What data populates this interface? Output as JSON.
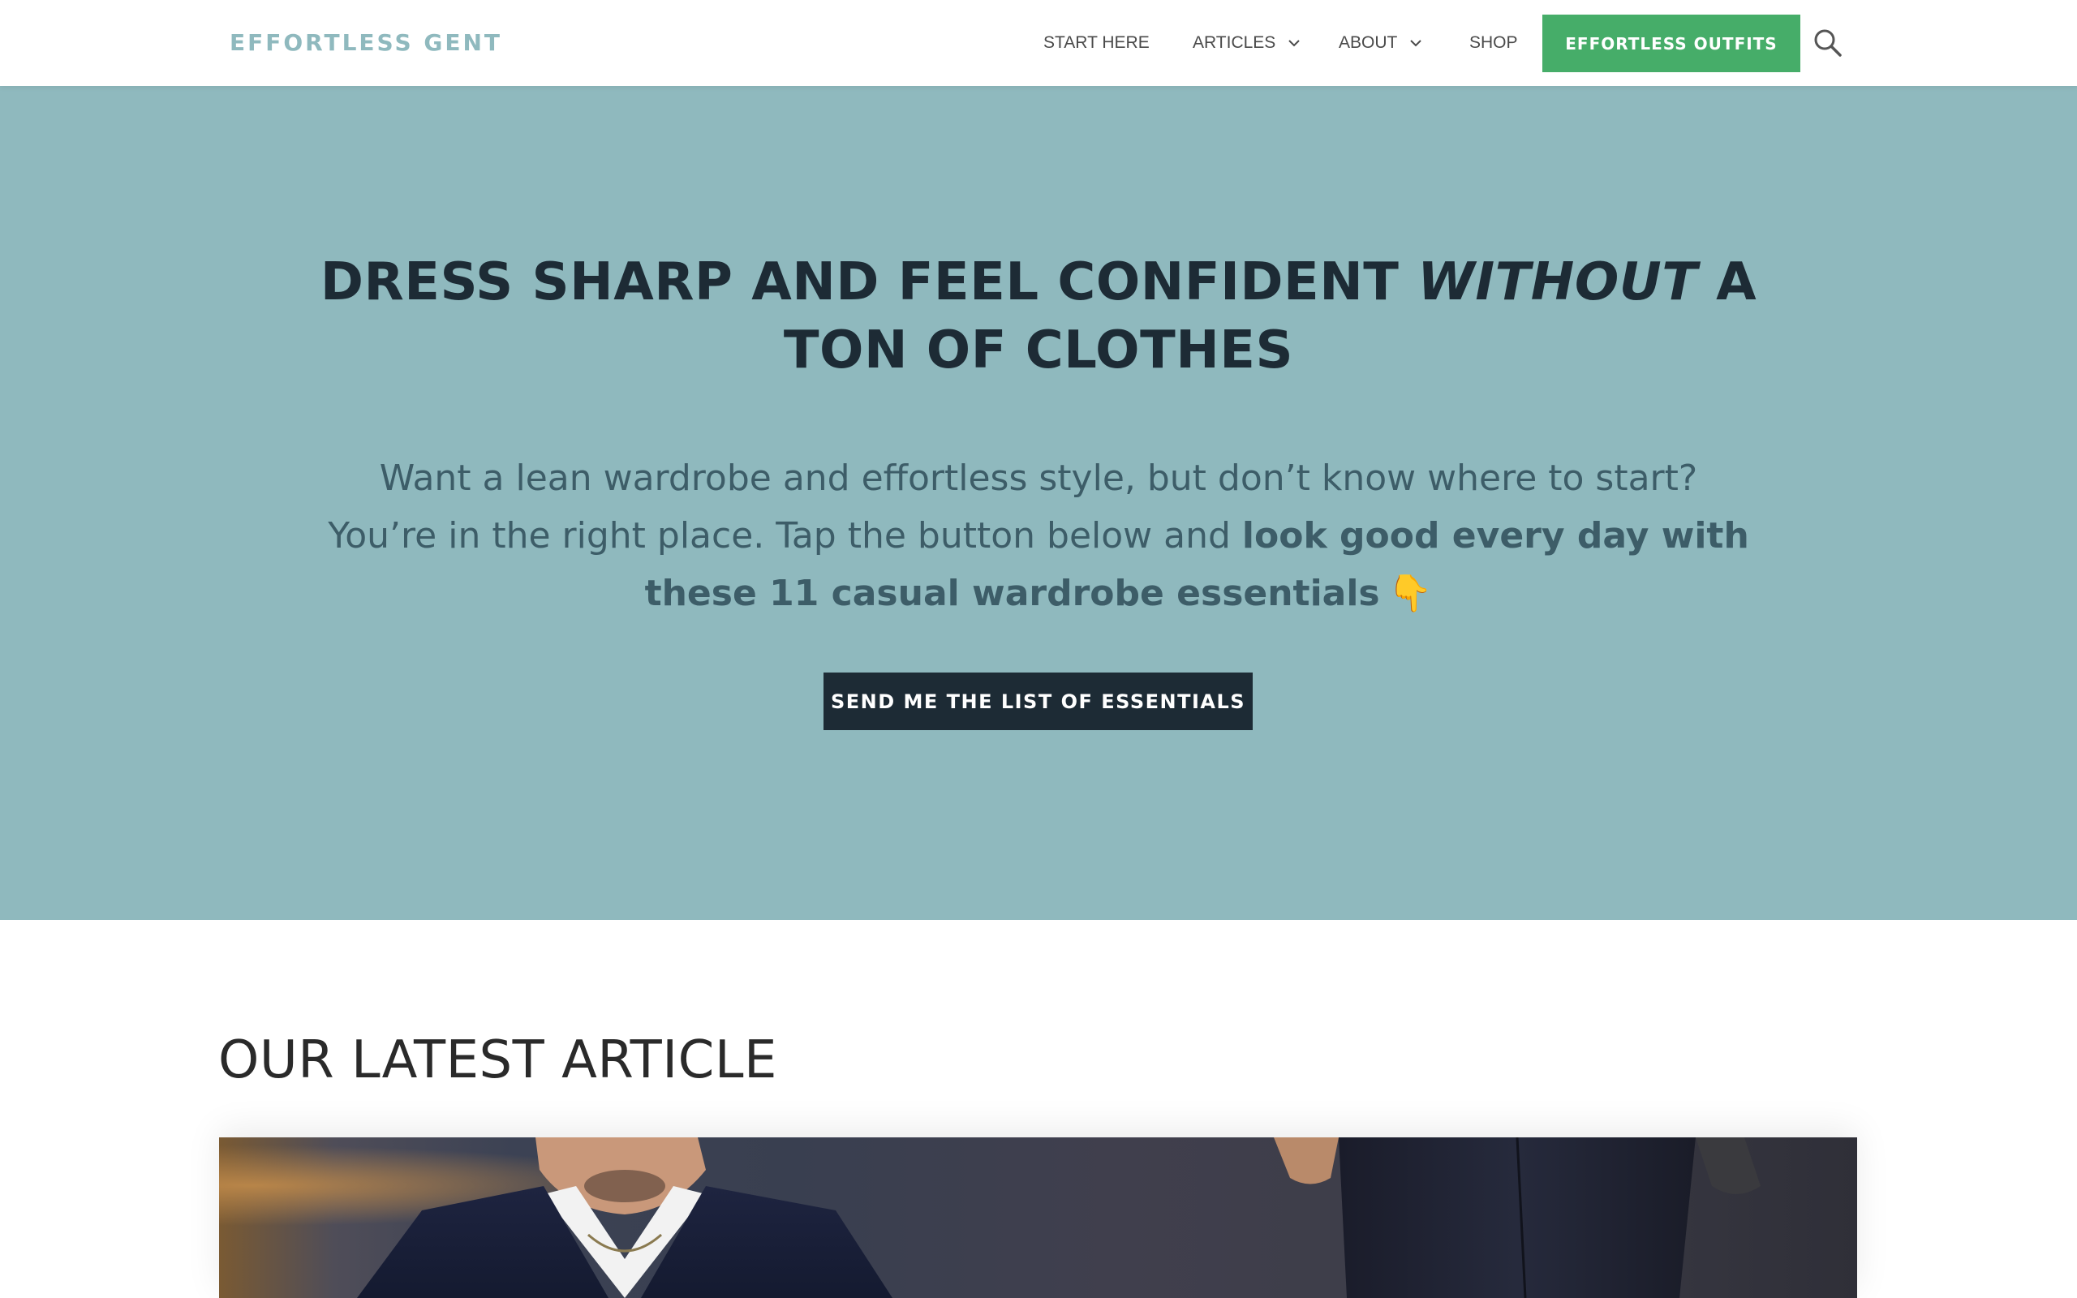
{
  "header": {
    "logo": "EFFORTLESS GENT",
    "nav": {
      "start_here": "START HERE",
      "articles": "ARTICLES",
      "about": "ABOUT",
      "shop": "SHOP"
    },
    "cta_label": "EFFORTLESS OUTFITS"
  },
  "hero": {
    "title_part1": "DRESS SHARP AND FEEL CONFIDENT ",
    "title_emphasis": "WITHOUT",
    "title_part2": " A TON OF CLOTHES",
    "text_part1": "Want a lean wardrobe and effortless style, but don’t know where to start? You’re in the right place. Tap the button below and ",
    "text_bold": "look good every day with these 11 casual wardrobe essentials",
    "emoji": "👇",
    "button_label": "SEND ME THE LIST OF ESSENTIALS"
  },
  "latest": {
    "heading": "OUR LATEST ARTICLE"
  },
  "colors": {
    "hero_bg": "#8fb9be",
    "accent_green": "#46ad69",
    "dark_navy": "#1d2b35",
    "logo": "#8fb9be"
  },
  "icons": {
    "search": "search-icon",
    "dropdown": "chevron-down-icon",
    "pointing": "pointing-down-icon"
  }
}
